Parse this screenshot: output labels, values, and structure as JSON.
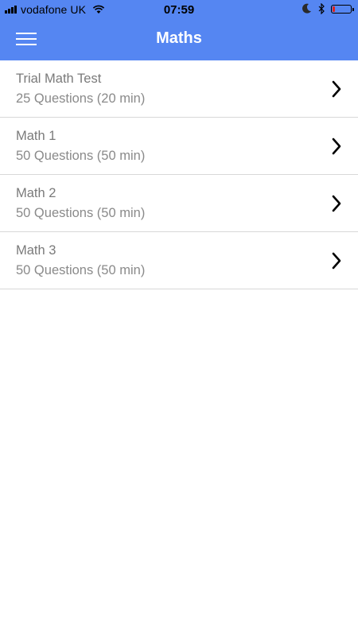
{
  "status_bar": {
    "carrier": "vodafone UK",
    "time": "07:59",
    "battery_level": 0.12,
    "battery_color": "#e0231b"
  },
  "header": {
    "title": "Maths",
    "background": "#5586f2",
    "menu_icon": "hamburger-icon"
  },
  "tests": [
    {
      "title": "Trial Math Test",
      "subtitle": "25 Questions (20 min)"
    },
    {
      "title": "Math 1",
      "subtitle": "50 Questions (50 min)"
    },
    {
      "title": "Math 2",
      "subtitle": "50 Questions (50 min)"
    },
    {
      "title": "Math 3",
      "subtitle": "50 Questions (50 min)"
    }
  ]
}
